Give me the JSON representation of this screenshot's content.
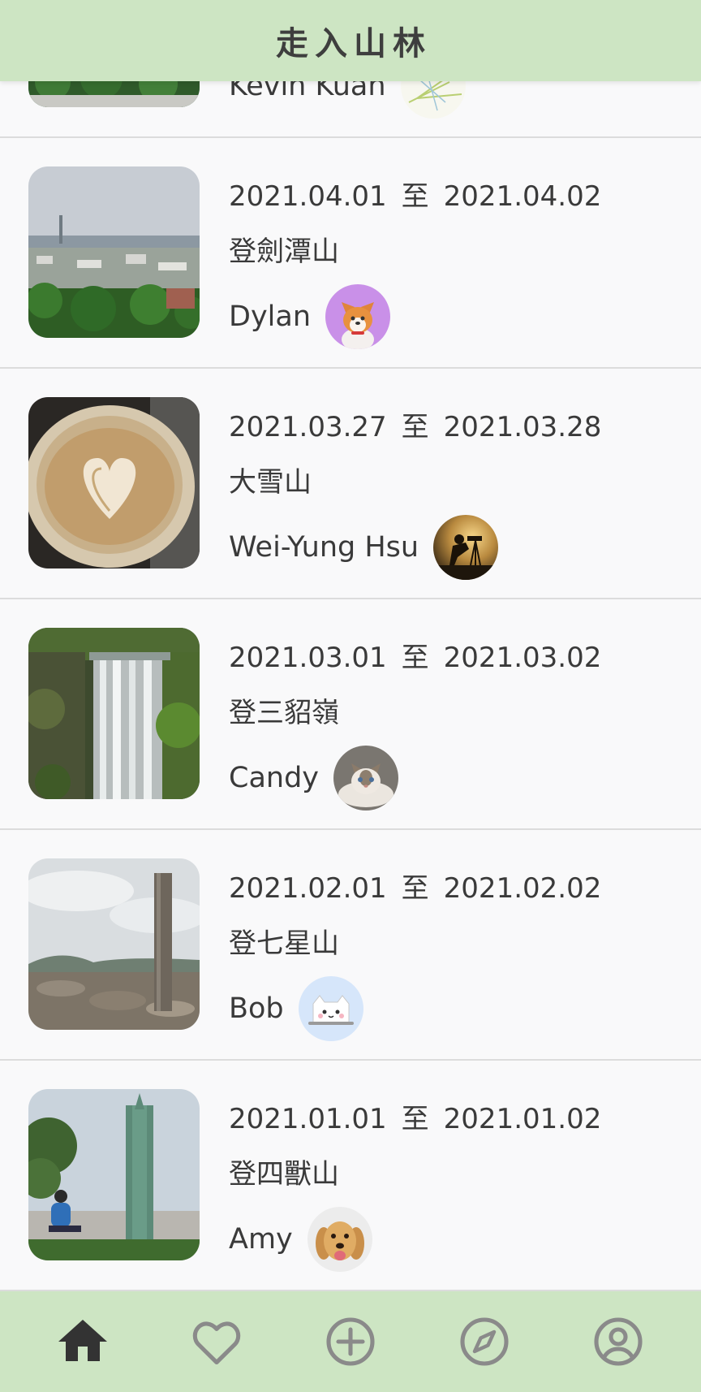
{
  "app": {
    "title": "走入山林"
  },
  "feed": {
    "date_separator": "至",
    "partial_card": {
      "author": "Kevin Kuan"
    },
    "cards": [
      {
        "start": "2021.04.01",
        "end": "2021.04.02",
        "title": "登劍潭山",
        "author": "Dylan",
        "thumb": "city-view-photo",
        "avatar": "corgi-avatar"
      },
      {
        "start": "2021.03.27",
        "end": "2021.03.28",
        "title": "大雪山",
        "author": "Wei-Yung Hsu",
        "thumb": "latte-art-photo",
        "avatar": "photographer-silhouette-avatar"
      },
      {
        "start": "2021.03.01",
        "end": "2021.03.02",
        "title": "登三貂嶺",
        "author": "Candy",
        "thumb": "waterfall-photo",
        "avatar": "cat-avatar"
      },
      {
        "start": "2021.02.01",
        "end": "2021.02.02",
        "title": "登七星山",
        "author": "Bob",
        "thumb": "summit-marker-photo",
        "avatar": "cartoon-cat-avatar"
      },
      {
        "start": "2021.01.01",
        "end": "2021.01.02",
        "title": "登四獸山",
        "author": "Amy",
        "thumb": "taipei101-photo",
        "avatar": "golden-retriever-avatar"
      }
    ]
  },
  "nav": {
    "items": [
      {
        "icon": "home-icon",
        "active": true
      },
      {
        "icon": "heart-icon",
        "active": false
      },
      {
        "icon": "add-circle-icon",
        "active": false
      },
      {
        "icon": "compass-icon",
        "active": false
      },
      {
        "icon": "account-icon",
        "active": false
      }
    ]
  },
  "colors": {
    "header_bg": "#cde5c3",
    "nav_bg": "#cde5c3",
    "active_icon": "#333333",
    "inactive_icon": "#8a8a8a",
    "divider": "#dcdcdc"
  }
}
